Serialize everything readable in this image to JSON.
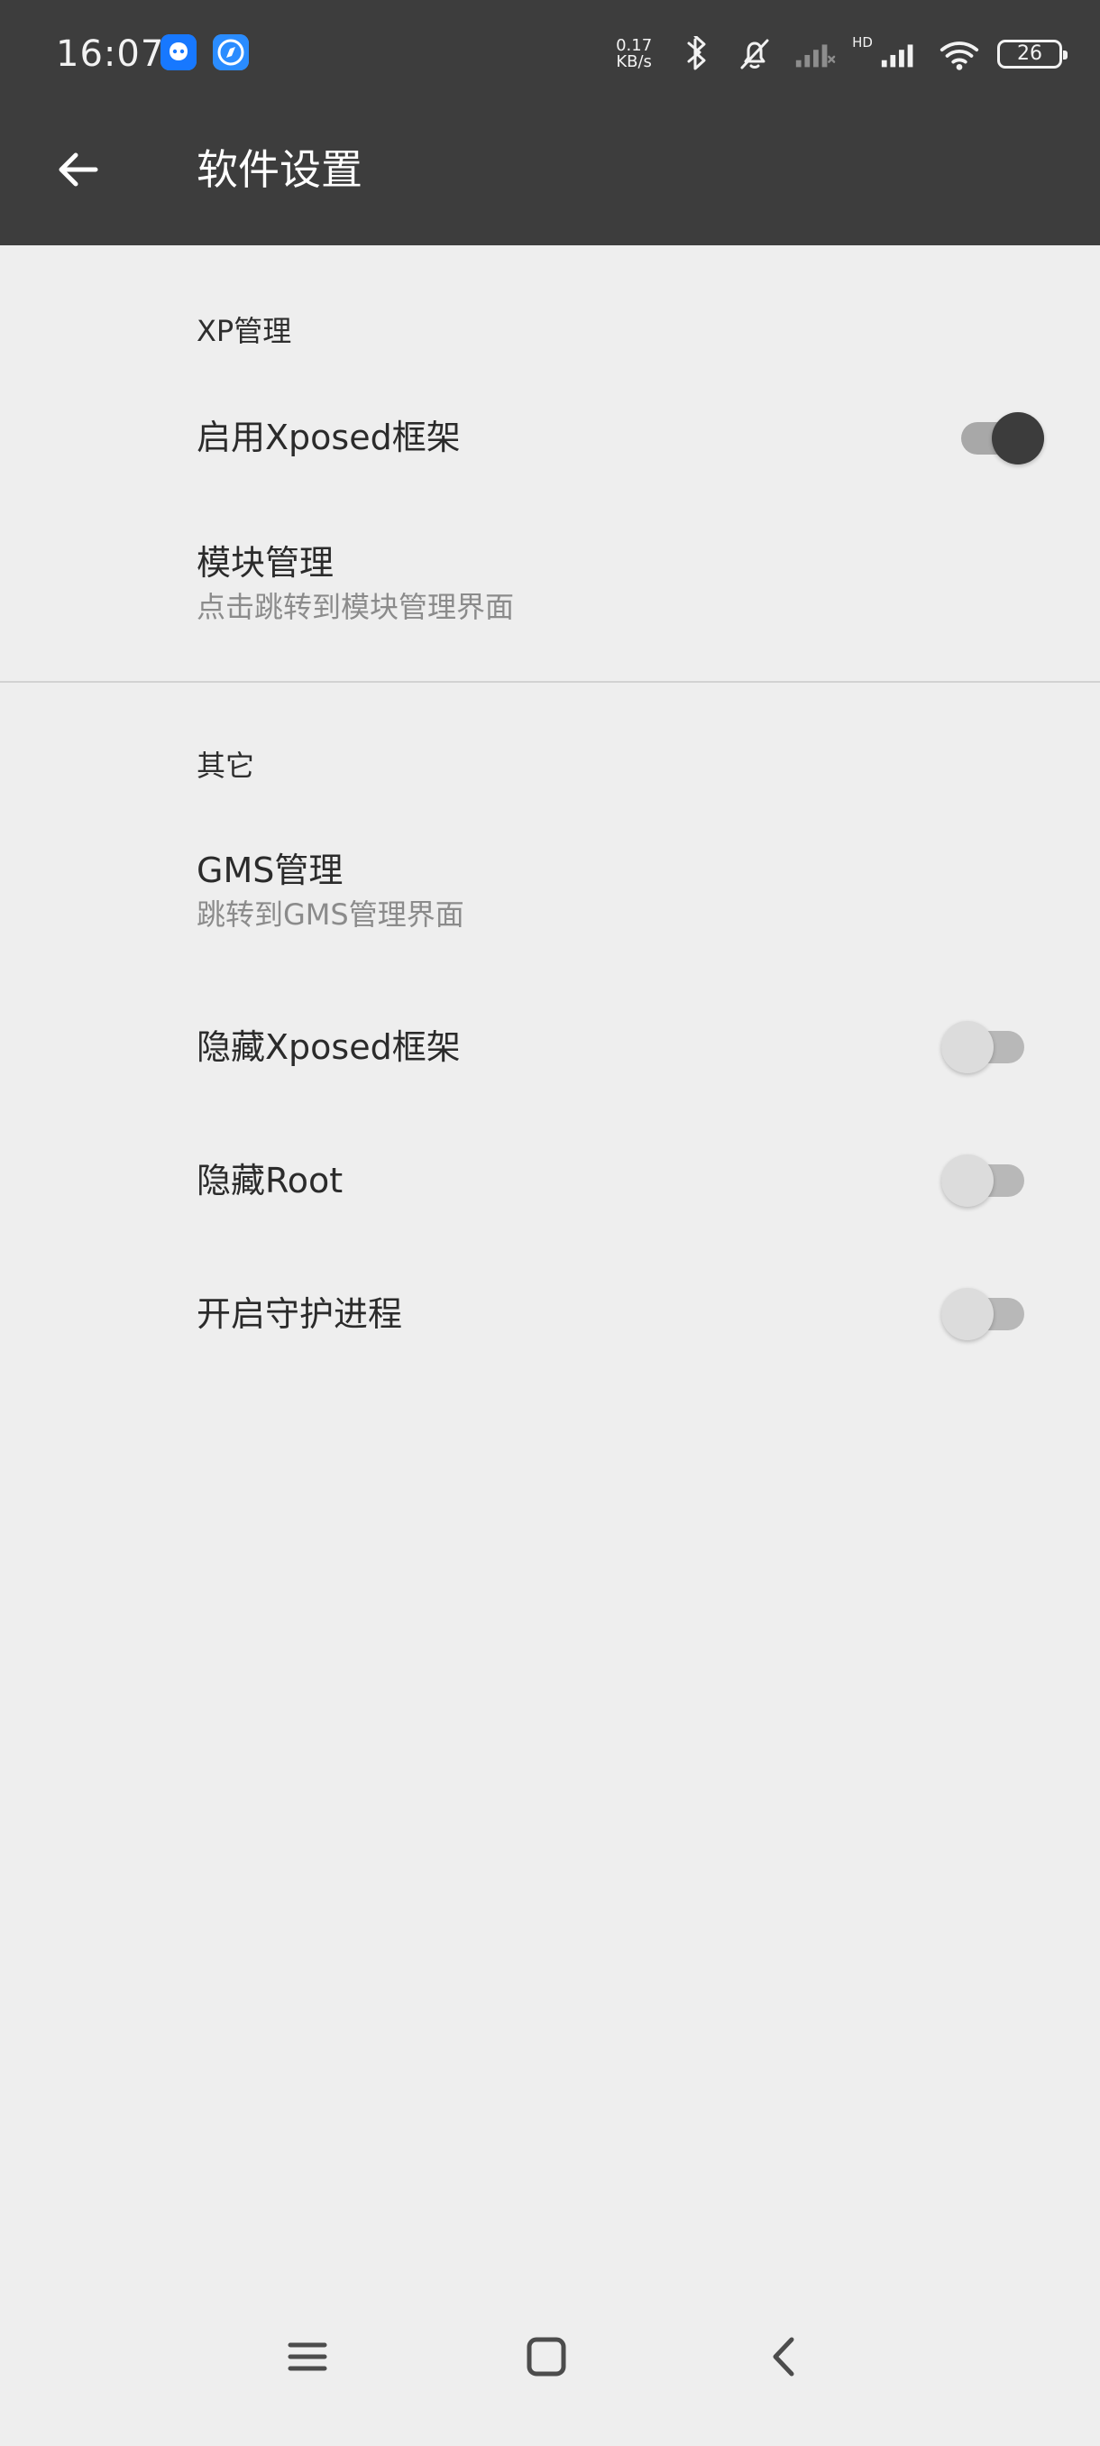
{
  "status_bar": {
    "time": "16:07",
    "network_speed": "0.17\nKB/s",
    "hd_label": "HD",
    "battery": "26",
    "icons": [
      "app-notification-icon",
      "compass-icon",
      "bluetooth-icon",
      "muted-bell-icon",
      "signal-icon",
      "signal-icon",
      "wifi-icon",
      "battery-icon"
    ]
  },
  "header": {
    "title": "软件设置",
    "back_icon": "back-arrow-icon"
  },
  "sections": [
    {
      "title": "XP管理",
      "items": [
        {
          "title": "启用Xposed框架",
          "toggle": true
        },
        {
          "title": "模块管理",
          "summary": "点击跳转到模块管理界面"
        }
      ]
    },
    {
      "title": "其它",
      "items": [
        {
          "title": "GMS管理",
          "summary": "跳转到GMS管理界面"
        },
        {
          "title": "隐藏Xposed框架",
          "toggle": false
        },
        {
          "title": "隐藏Root",
          "toggle": false
        },
        {
          "title": "开启守护进程",
          "toggle": false
        }
      ]
    }
  ],
  "navigation_icons": [
    "menu-icon",
    "home-square-icon",
    "chevron-left-icon"
  ],
  "colors": {
    "top_bar": "#3d3d3d",
    "background": "#eeeeee",
    "text_primary": "#2b2b2b",
    "text_secondary": "#8b8b8b",
    "toggle_on": "#3c3c3c",
    "toggle_off": "#dcdcdc"
  }
}
